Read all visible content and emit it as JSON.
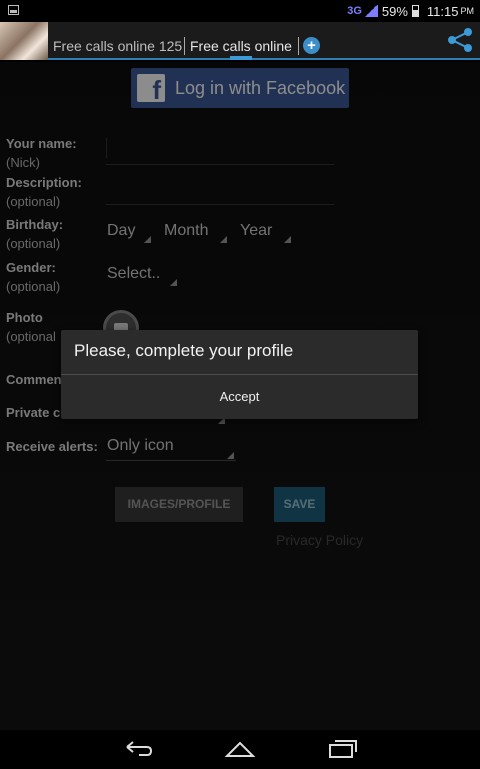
{
  "status_bar": {
    "network": "3G",
    "battery": "59%",
    "time": "11:15",
    "ampm": "PM"
  },
  "action_bar": {
    "tab1": "Free calls online 125",
    "tab2": "Free calls online",
    "icons": [
      "app-thumbnail",
      "add-icon",
      "share-icon"
    ]
  },
  "facebook": {
    "label": "Log in with Facebook",
    "logo": "f",
    "color": "#3b5998"
  },
  "form": {
    "name_label": "Your name:",
    "name_hint": "(Nick)",
    "description_label": "Description:",
    "description_hint": "(optional)",
    "birthday_label": "Birthday:",
    "birthday_hint": "(optional)",
    "birthday_day": "Day",
    "birthday_month": "Month",
    "birthday_year": "Year",
    "gender_label": "Gender:",
    "gender_hint": "(optional)",
    "gender_value": "Select..",
    "photo_label": "Photo",
    "photo_hint": "(optional",
    "comments_label": "Commen",
    "private_label": "Private c",
    "alerts_label": "Receive alerts:",
    "alerts_value": "Only icon"
  },
  "buttons": {
    "images_profile": "IMAGES/PROFILE",
    "save": "SAVE",
    "privacy": "Privacy Policy"
  },
  "dialog": {
    "title": "Please, complete your profile",
    "accept": "Accept"
  },
  "nav": {
    "icons": [
      "back-icon",
      "home-icon",
      "recents-icon"
    ]
  }
}
